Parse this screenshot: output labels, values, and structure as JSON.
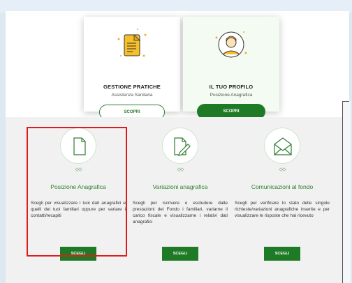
{
  "top_cards": [
    {
      "title": "GESTIONE PRATICHE",
      "subtitle": "Assistenza Sanitaria",
      "button": "SCOPRI",
      "icon": "document-icon"
    },
    {
      "title": "IL TUO PROFILO",
      "subtitle": "Posizione Anagrafica",
      "button": "SCOPRI",
      "icon": "user-profile-icon"
    }
  ],
  "options": [
    {
      "title": "Posizione Anagrafica",
      "description": "Scegli per visualizzare i tuoi dati anagrafici e quelli dei tuoi familiari oppure per variare i contatti/recapiti",
      "button": "SCEGLI",
      "dots": "◇◇",
      "icon": "blank-document-icon"
    },
    {
      "title": "Variazioni anagrafica",
      "description": "Scegli per iscrivere o escludere dalle prestazioni del Fondo i familiari, variarne il carico fiscale e visualizzarne i relativi dati anagrafici",
      "button": "SCEGLI",
      "dots": "◇◇",
      "icon": "edit-document-icon"
    },
    {
      "title": "Comunicazioni al fondo",
      "description": "Scegli per verificare lo stato delle singole richieste/variazioni anagrafiche inserite e per visualizzare le risposte che hai ricevuto",
      "button": "SCEGLI",
      "dots": "◇◇",
      "icon": "envelope-icon"
    }
  ],
  "colors": {
    "accent": "#1f7a25",
    "highlight": "#e01b1b"
  }
}
